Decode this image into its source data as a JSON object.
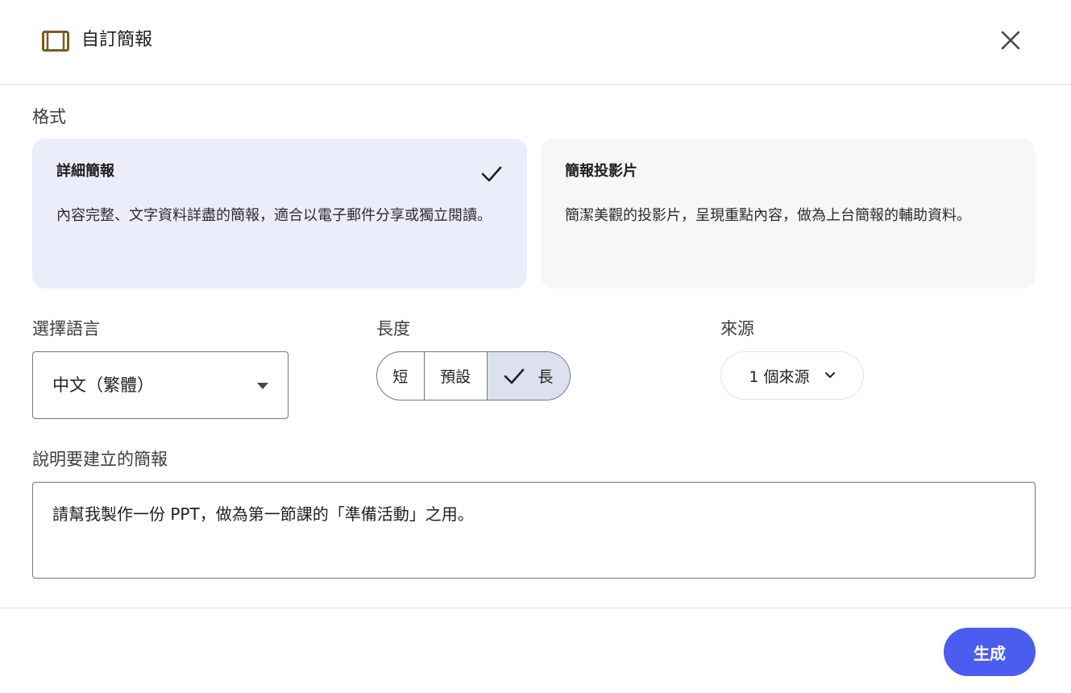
{
  "header": {
    "title": "自訂簡報",
    "icon": "slides-icon",
    "close_icon": "close-icon"
  },
  "format": {
    "label": "格式",
    "options": [
      {
        "title": "詳細簡報",
        "description": "內容完整、文字資料詳盡的簡報，適合以電子郵件分享或獨立閱讀。",
        "selected": true
      },
      {
        "title": "簡報投影片",
        "description": "簡潔美觀的投影片，呈現重點內容，做為上台簡報的輔助資料。",
        "selected": false
      }
    ]
  },
  "language": {
    "label": "選擇語言",
    "value": "中文（繁體）"
  },
  "length": {
    "label": "長度",
    "options": [
      "短",
      "預設",
      "長"
    ],
    "selected": "長"
  },
  "source": {
    "label": "來源",
    "value": "1 個來源"
  },
  "prompt": {
    "label": "說明要建立的簡報",
    "value": "請幫我製作一份 PPT，做為第一節課的「準備活動」之用。"
  },
  "footer": {
    "generate_label": "生成"
  },
  "colors": {
    "accent": "#4b5cf0",
    "selected_card": "#ecedfa",
    "icon_brown": "#7a5c1e"
  }
}
